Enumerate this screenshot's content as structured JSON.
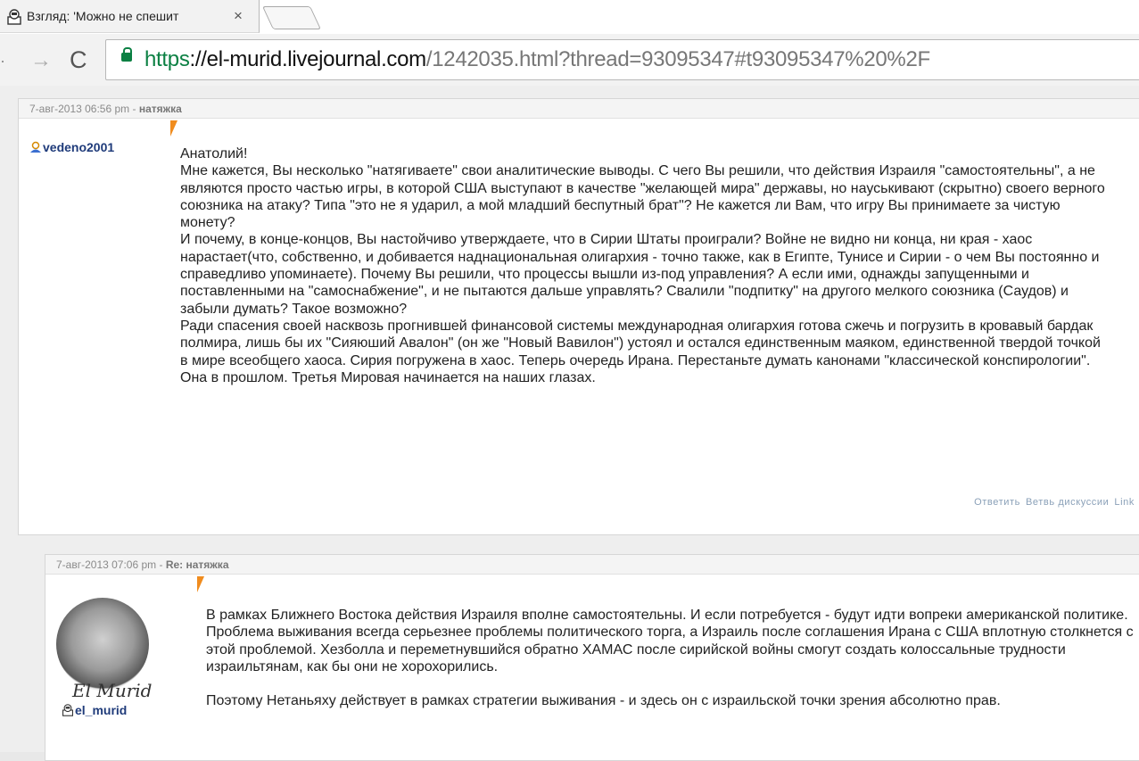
{
  "browser": {
    "tab_title": "Взгляд: 'Можно не спешит",
    "url": {
      "scheme": "https",
      "separator": "://",
      "host": "el-murid.livejournal.com",
      "path": "/1242035.html?thread=93095347#t93095347%20%2F"
    }
  },
  "comments": [
    {
      "date": "7-авг-2013 06:56 pm",
      "date_separator": " - ",
      "subject": "натяжка",
      "author": "vedeno2001",
      "paragraphs": [
        "Анатолий!",
        "Мне кажется, Вы несколько \"натягиваете\" свои аналитические выводы. С чего Вы решили, что действия Израиля \"самостоятельны\", а не являются просто частью игры, в которой США выступают в качестве \"желающей мира\" державы, но науськивают (скрытно) своего верного союзника на атаку? Типа \"это не я ударил, а мой младший беспутный брат\"? Не кажется ли Вам, что игру Вы принимаете за чистую монету?",
        "И почему, в конце-концов, Вы настойчиво утверждаете, что в Сирии Штаты проиграли? Войне не видно ни конца, ни края - хаос нарастает(что, собственно, и добивается наднациональная олигархия - точно также, как в Египте, Тунисе и Сирии - о чем Вы постоянно и справедливо упоминаете). Почему Вы решили, что процессы вышли из-под управления? А если ими, однажды запущенными и поставленными на \"самоснабжение\", и не пытаются дальше управлять? Свалили \"подпитку\" на другого мелкого союзника (Саудов) и забыли думать? Такое возможно?",
        "Ради спасения своей насквозь прогнившей финансовой системы международная олигархия готова сжечь и погрузить в кровавый бардак полмира, лишь бы их \"Сияюший Авалон\" (он же \"Новый Вавилон\") устоял и остался единственным маяком, единственной твердой точкой в мире всеобщего хаоса. Сирия погружена в хаос. Теперь очередь Ирана. Перестаньте думать канонами \"классической конспирологии\". Она в прошлом. Третья Мировая начинается на наших глазах."
      ],
      "actions": [
        "Ответить",
        "Ветвь дискуссии",
        "Link"
      ]
    },
    {
      "date": "7-авг-2013 07:06 pm",
      "date_separator": " - ",
      "subject": "Re: натяжка",
      "author": "el_murid",
      "avatar_signature": "El Murid",
      "paragraphs": [
        "В рамках Ближнего Востока действия Израиля вполне самостоятельны. И если потребуется - будут идти вопреки американской политике. Проблема выживания всегда серьезнее проблемы политического торга, а Израиль после соглашения Ирана с США вплотную столкнется с этой проблемой. Хезболла и переметнувшийся обратно ХАМАС после сирийской войны смогут создать колоссальные трудности израильтянам, как бы они не хорохорились.",
        "Поэтому Нетаньяху действует в рамках стратегии выживания - и здесь он с израильской точки зрения абсолютно прав."
      ]
    }
  ]
}
